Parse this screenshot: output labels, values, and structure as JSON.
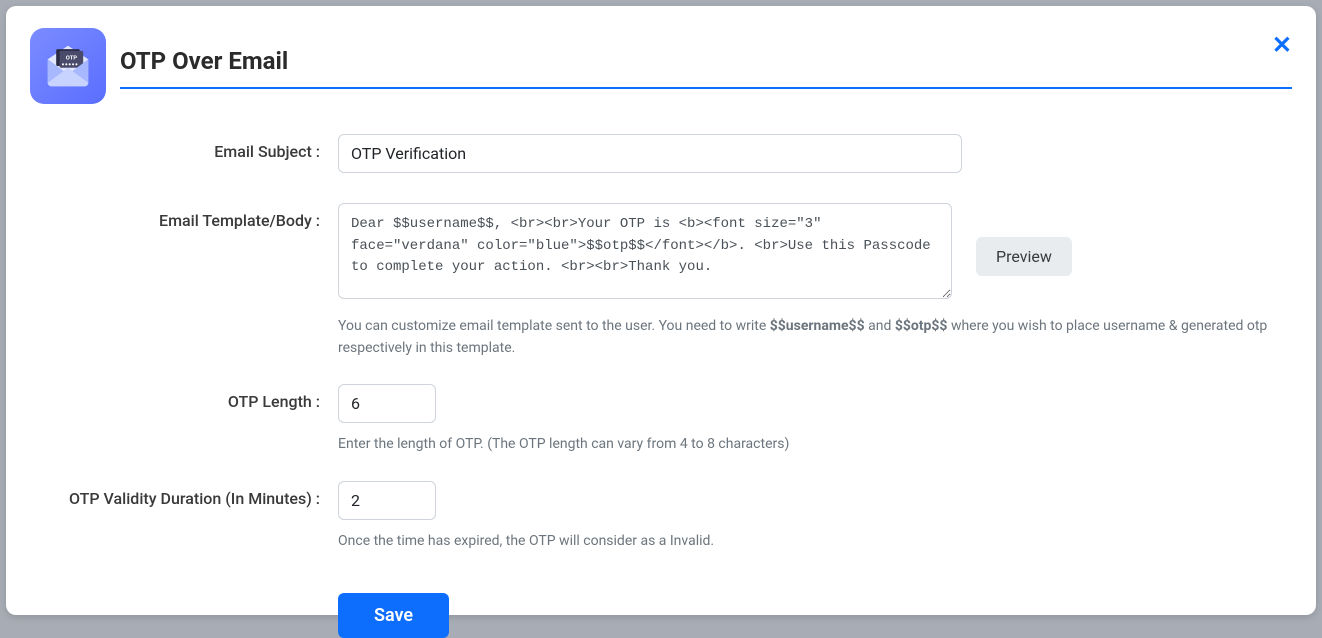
{
  "modal": {
    "title": "OTP Over Email"
  },
  "form": {
    "email_subject": {
      "label": "Email Subject :",
      "value": "OTP Verification"
    },
    "email_template": {
      "label": "Email Template/Body :",
      "value": "Dear $$username$$, <br><br>Your OTP is <b><font size=\"3\" face=\"verdana\" color=\"blue\">$$otp$$</font></b>. <br>Use this Passcode to complete your action. <br><br>Thank you.",
      "preview_label": "Preview",
      "help_prefix": "You can customize email template sent to the user. You need to write ",
      "help_token1": "$$username$$",
      "help_mid": " and ",
      "help_token2": "$$otp$$",
      "help_suffix": " where you wish to place username & generated otp respectively in this template."
    },
    "otp_length": {
      "label": "OTP Length :",
      "value": "6",
      "help": "Enter the length of OTP. (The OTP length can vary from 4 to 8 characters)"
    },
    "otp_validity": {
      "label": "OTP Validity Duration (In Minutes) :",
      "value": "2",
      "help": "Once the time has expired, the OTP will consider as a Invalid."
    },
    "save_label": "Save"
  }
}
